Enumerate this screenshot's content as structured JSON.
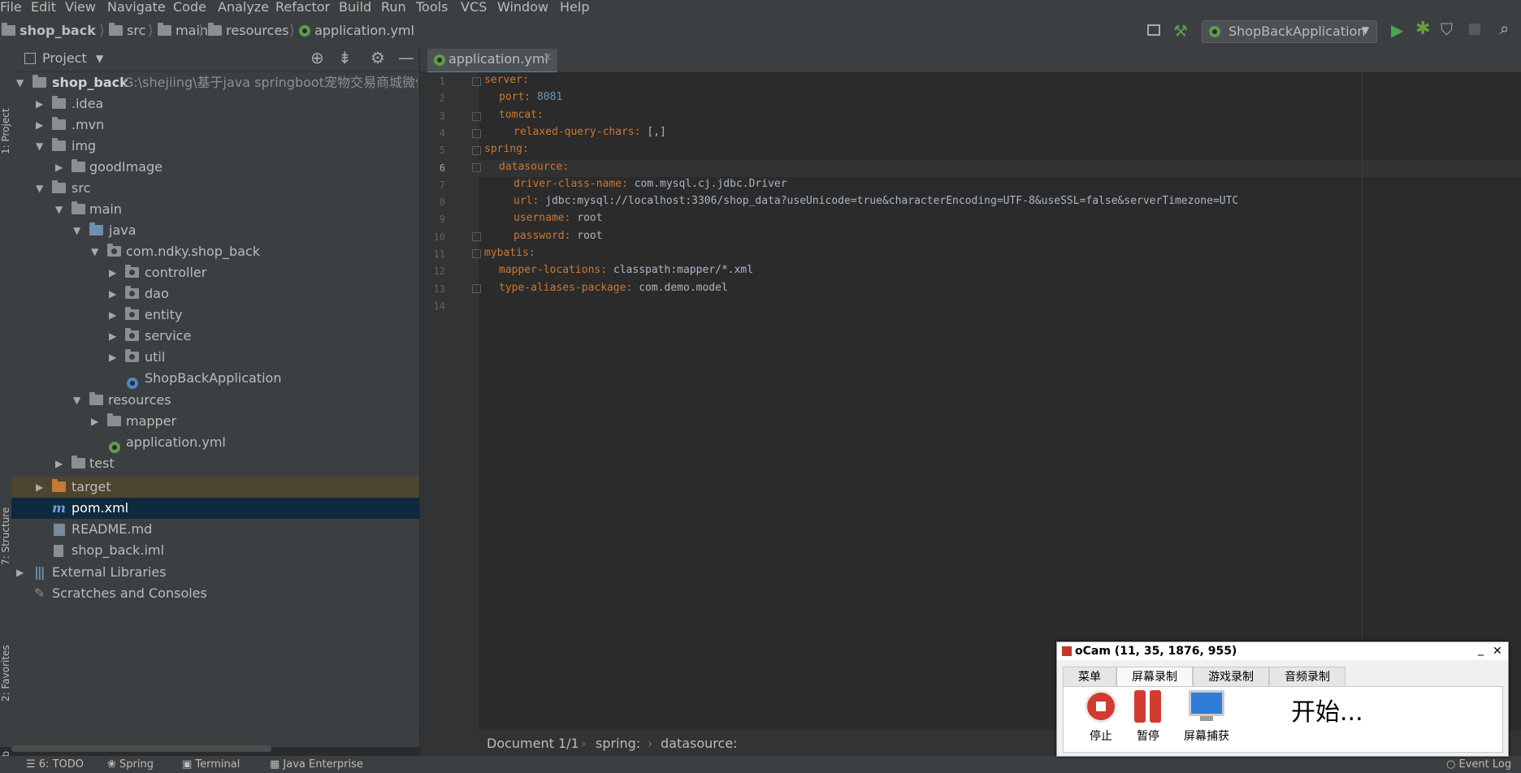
{
  "menu": [
    "File",
    "Edit",
    "View",
    "Navigate",
    "Code",
    "Analyze",
    "Refactor",
    "Build",
    "Run",
    "Tools",
    "VCS",
    "Window",
    "Help"
  ],
  "breadcrumb": [
    "shop_back",
    "src",
    "main",
    "resources",
    "application.yml"
  ],
  "run_config": "ShopBackApplication",
  "left_strip": {
    "project": "1: Project",
    "structure": "7: Structure",
    "favorites": "2: Favorites",
    "web": "Web"
  },
  "project_panel": {
    "title": "Project",
    "root_name": "shop_back",
    "root_path": "G:\\shejiing\\基于java springboot宠物交易商城微信小",
    "items": [
      ".idea",
      ".mvn",
      "img",
      "goodImage",
      "src",
      "main",
      "java",
      "com.ndky.shop_back",
      "controller",
      "dao",
      "entity",
      "service",
      "util",
      "ShopBackApplication",
      "resources",
      "mapper",
      "application.yml",
      "test",
      "target",
      "pom.xml",
      "README.md",
      "shop_back.iml",
      "External Libraries",
      "Scratches and Consoles"
    ]
  },
  "editor": {
    "tab": "application.yml",
    "line_numbers": [
      "1",
      "2",
      "3",
      "4",
      "5",
      "6",
      "7",
      "8",
      "9",
      "10",
      "11",
      "12",
      "13",
      "14"
    ],
    "lines": [
      {
        "key": "server:",
        "value": ""
      },
      {
        "key": "port:",
        "value": "8081",
        "num": true
      },
      {
        "key": "tomcat:",
        "value": ""
      },
      {
        "key": "relaxed-query-chars:",
        "value": "[,]"
      },
      {
        "key": "spring:",
        "value": ""
      },
      {
        "key": "datasource:",
        "value": ""
      },
      {
        "key": "driver-class-name:",
        "value": "com.mysql.cj.jdbc.Driver"
      },
      {
        "key": "url:",
        "value": "jdbc:mysql://localhost:3306/shop_data?useUnicode=true&characterEncoding=UTF-8&useSSL=false&serverTimezone=UTC"
      },
      {
        "key": "username:",
        "value": "root"
      },
      {
        "key": "password:",
        "value": "root"
      },
      {
        "key": "mybatis:",
        "value": ""
      },
      {
        "key": "mapper-locations:",
        "value": "classpath:mapper/*.xml"
      },
      {
        "key": "type-aliases-package:",
        "value": "com.demo.model"
      },
      {
        "key": "",
        "value": ""
      }
    ],
    "status_crumbs": [
      "Document 1/1",
      "spring:",
      "datasource:"
    ]
  },
  "bottom_tabs": [
    "6: TODO",
    "Spring",
    "Terminal",
    "Java Enterprise",
    "Event Log"
  ],
  "ocam": {
    "title": "oCam (11, 35, 1876, 955)",
    "tabs": [
      "菜单",
      "屏幕录制",
      "游戏录制",
      "音频录制"
    ],
    "buttons": [
      "停止",
      "暂停",
      "屏幕捕获"
    ],
    "status": "开始..."
  },
  "colors": {
    "keyword": "#cc7832",
    "value": "#a9b7c6",
    "number": "#6897bb",
    "selected_row": "#0d293e",
    "target_row": "#4c4530"
  }
}
